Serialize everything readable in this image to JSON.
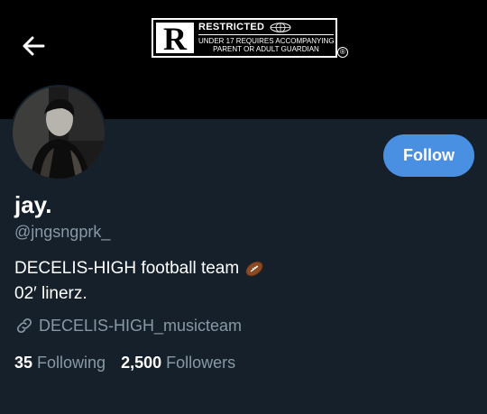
{
  "header": {
    "background": "#000000",
    "back_icon": "arrow-left-icon",
    "rating_badge": {
      "letter": "R",
      "title": "RESTRICTED",
      "line1": "UNDER 17 REQUIRES ACCOMPANYING",
      "line2": "PARENT OR ADULT GUARDIAN",
      "registered_mark": "®"
    }
  },
  "profile": {
    "display_name": "jay.",
    "handle": "@jngsngprk_",
    "follow_label": "Follow",
    "bio_line1": "DECELIS-HIGH football team",
    "bio_line1_icon": "football-icon",
    "bio_line2": "02′ linerz.",
    "link_icon": "link-icon",
    "link_text": "DECELIS-HIGH_musicteam"
  },
  "stats": {
    "following_count": "35",
    "following_label": "Following",
    "followers_count": "2,500",
    "followers_label": "Followers"
  },
  "colors": {
    "background": "#15202b",
    "accent": "#4a90e2",
    "secondary_text": "#8899a6",
    "primary_text": "#ffffff"
  }
}
